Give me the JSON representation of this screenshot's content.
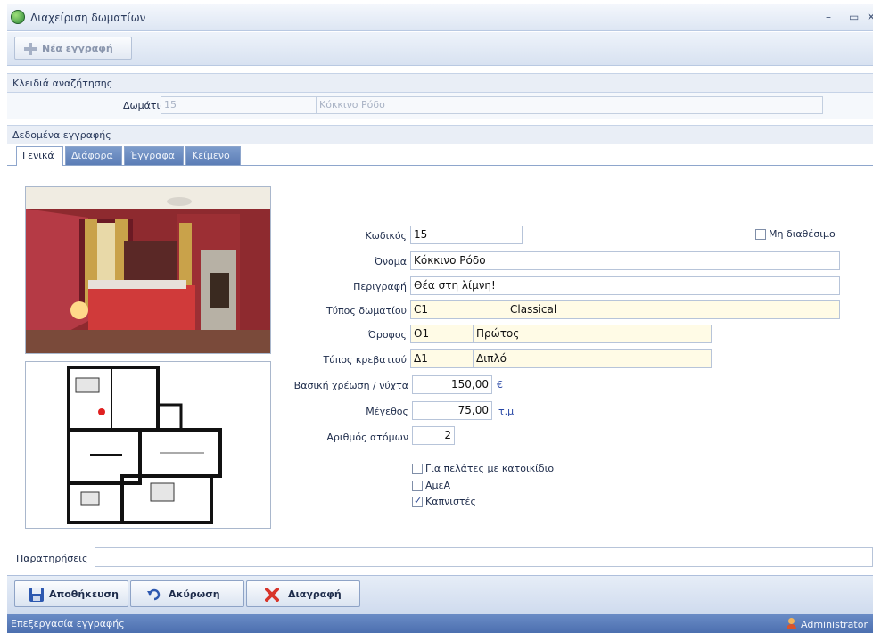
{
  "window": {
    "title": "Διαχείριση δωματίων",
    "minimize": "–",
    "maximize": "▭",
    "close": "✕"
  },
  "toolbar": {
    "new_label": "Νέα εγγραφή"
  },
  "search": {
    "header": "Κλειδιά αναζήτησης",
    "room_label": "Δωμάτιο",
    "room_code": "15",
    "room_name": "Κόκκινο Ρόδο"
  },
  "record": {
    "header": "Δεδομένα εγγραφής"
  },
  "tabs": [
    {
      "label": "Γενικά",
      "active": true
    },
    {
      "label": "Διάφορα",
      "active": false
    },
    {
      "label": "Έγγραφα",
      "active": false
    },
    {
      "label": "Κείμενο",
      "active": false
    }
  ],
  "form": {
    "code_label": "Κωδικός",
    "code": "15",
    "unavailable_label": "Μη διαθέσιμο",
    "unavailable_checked": false,
    "name_label": "Όνομα",
    "name": "Κόκκινο Ρόδο",
    "description_label": "Περιγραφή",
    "description": "Θέα στη λίμνη!",
    "room_type_label": "Τύπος δωματίου",
    "room_type_code": "C1",
    "room_type_name": "Classical",
    "floor_label": "Όροφος",
    "floor_code": "O1",
    "floor_name": "Πρώτος",
    "bed_type_label": "Τύπος κρεβατιού",
    "bed_type_code": "Δ1",
    "bed_type_name": "Διπλό",
    "base_rate_label": "Βασική χρέωση / νύχτα",
    "base_rate": "150,00",
    "currency": "€",
    "size_label": "Μέγεθος",
    "size": "75,00",
    "size_unit": "τ.μ",
    "persons_label": "Αριθμός ατόμων",
    "persons": "2",
    "pets_label": "Για πελάτες με κατοικίδιο",
    "pets_checked": false,
    "disabled_label": "ΑμεΑ",
    "disabled_checked": false,
    "smokers_label": "Καπνιστές",
    "smokers_checked": true
  },
  "notes": {
    "label": "Παρατηρήσεις",
    "value": ""
  },
  "actions": {
    "save": "Αποθήκευση",
    "cancel": "Ακύρωση",
    "delete": "Διαγραφή"
  },
  "status": {
    "left": "Επεξεργασία εγγραφής",
    "user": "Administrator"
  },
  "colors": {
    "accent": "#5b7db6",
    "lookup_bg": "#fffbe6",
    "delete_red": "#d8342a"
  }
}
